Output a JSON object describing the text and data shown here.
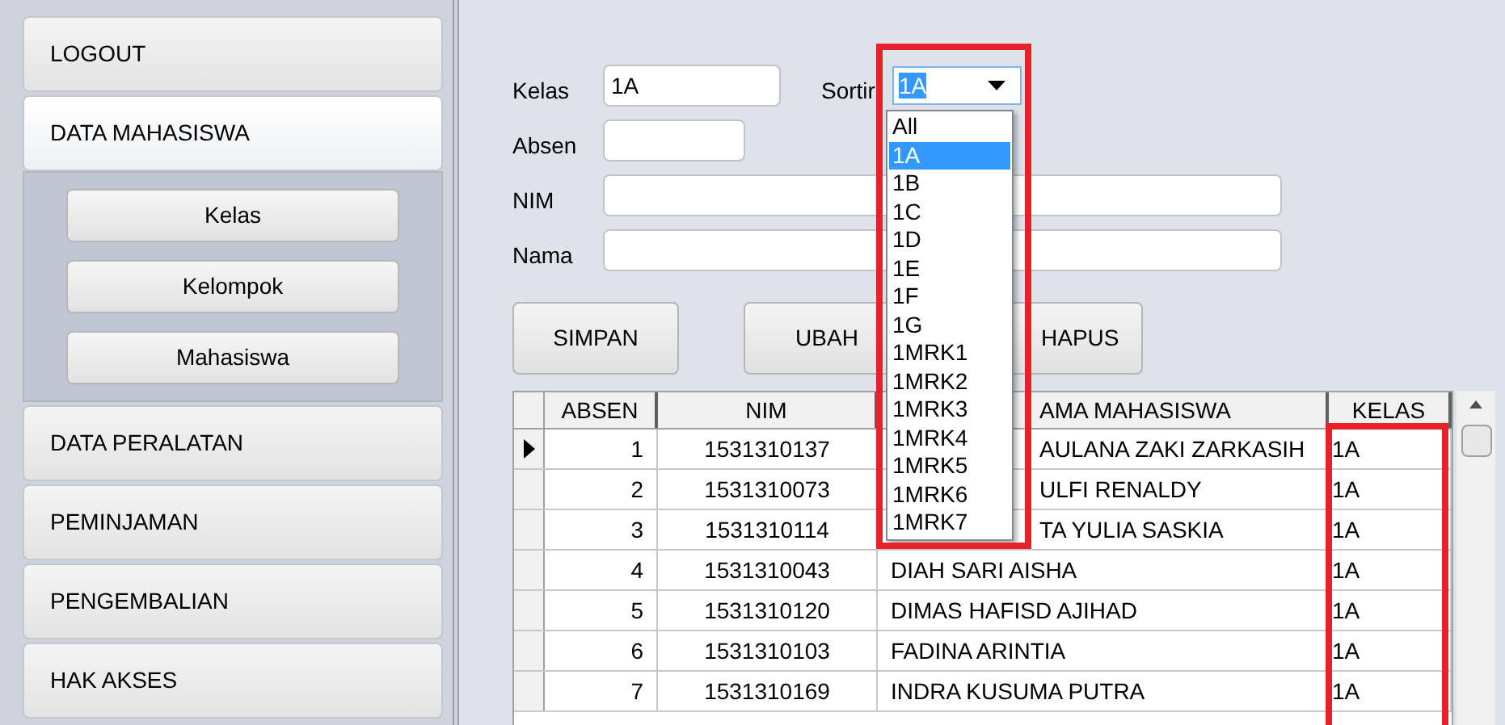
{
  "sidebar": {
    "items": [
      {
        "label": "LOGOUT",
        "expanded": false
      },
      {
        "label": "DATA MAHASISWA",
        "expanded": true,
        "children": [
          {
            "label": "Kelas"
          },
          {
            "label": "Kelompok"
          },
          {
            "label": "Mahasiswa"
          }
        ]
      },
      {
        "label": "DATA PERALATAN",
        "expanded": false
      },
      {
        "label": "PEMINJAMAN",
        "expanded": false
      },
      {
        "label": "PENGEMBALIAN",
        "expanded": false
      },
      {
        "label": "HAK AKSES",
        "expanded": false
      }
    ]
  },
  "form": {
    "fields": [
      {
        "label": "Kelas",
        "value": "1A"
      },
      {
        "label": "Absen"
      },
      {
        "label": "NIM"
      },
      {
        "label": "Nama"
      }
    ],
    "sort": {
      "label": "Sortir",
      "value": "1A"
    },
    "buttons": [
      "SIMPAN",
      "UBAH",
      "HAPUS"
    ]
  },
  "dropdown": {
    "options": [
      {
        "label": "All",
        "selected": false
      },
      {
        "label": "1A",
        "selected": true
      },
      {
        "label": "1B",
        "selected": false
      },
      {
        "label": "1C",
        "selected": false
      },
      {
        "label": "1D",
        "selected": false
      },
      {
        "label": "1E",
        "selected": false
      },
      {
        "label": "1F",
        "selected": false
      },
      {
        "label": "1G",
        "selected": false
      },
      {
        "label": "1MRK1",
        "selected": false
      },
      {
        "label": "1MRK2",
        "selected": false
      },
      {
        "label": "1MRK3",
        "selected": false
      },
      {
        "label": "1MRK4",
        "selected": false
      },
      {
        "label": "1MRK5",
        "selected": false
      },
      {
        "label": "1MRK6",
        "selected": false
      },
      {
        "label": "1MRK7",
        "selected": false
      }
    ]
  },
  "table": {
    "columns": [
      {
        "label": "ABSEN",
        "covered": false
      },
      {
        "label": "NIM",
        "covered": false
      },
      {
        "label": "AMA MAHASISWA",
        "covered": true
      },
      {
        "label": "KELAS",
        "covered": false
      }
    ],
    "rows": [
      {
        "selected": true,
        "covered": true,
        "cells": [
          "1",
          "1531310137",
          "AULANA ZAKI ZARKASIH",
          "1A"
        ]
      },
      {
        "selected": false,
        "covered": true,
        "cells": [
          "2",
          "1531310073",
          "ULFI RENALDY",
          "1A"
        ]
      },
      {
        "selected": false,
        "covered": true,
        "cells": [
          "3",
          "1531310114",
          "TA YULIA SASKIA",
          "1A"
        ]
      },
      {
        "selected": false,
        "cells": [
          "4",
          "1531310043",
          "DIAH SARI AISHA",
          "1A"
        ]
      },
      {
        "selected": false,
        "cells": [
          "5",
          "1531310120",
          "DIMAS HAFISD AJIHAD",
          "1A"
        ]
      },
      {
        "selected": false,
        "cells": [
          "6",
          "1531310103",
          "FADINA ARINTIA",
          "1A"
        ]
      },
      {
        "selected": false,
        "cells": [
          "7",
          "1531310169",
          "INDRA KUSUMA PUTRA",
          "1A"
        ]
      }
    ]
  }
}
